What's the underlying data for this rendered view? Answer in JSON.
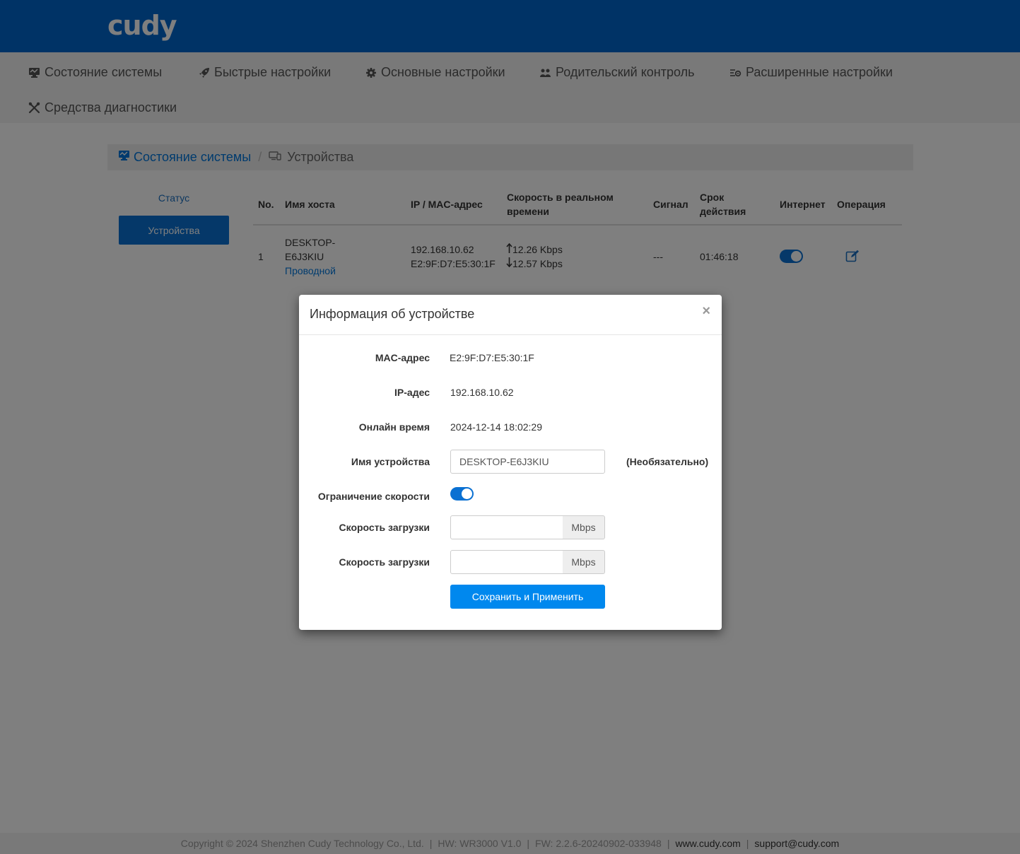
{
  "brand": {
    "logo": "cudy"
  },
  "nav": {
    "items": [
      {
        "label": "Состояние системы",
        "icon": "monitor-icon"
      },
      {
        "label": "Быстрые настройки",
        "icon": "rocket-icon"
      },
      {
        "label": "Основные настройки",
        "icon": "gear-icon"
      },
      {
        "label": "Родительский контроль",
        "icon": "users-icon"
      },
      {
        "label": "Расширенные настройки",
        "icon": "advanced-settings-icon"
      },
      {
        "label": "Средства диагностики",
        "icon": "tools-icon"
      }
    ]
  },
  "breadcrumb": {
    "parent": "Состояние системы",
    "separator": "/",
    "current": "Устройства"
  },
  "sidenav": {
    "status": "Статус",
    "devices": "Устройства"
  },
  "table": {
    "headers": {
      "no": "No.",
      "hostname": "Имя хоста",
      "ipmac": "IP / MAC-адрес",
      "speed_l1": "Скорость в реальном",
      "speed_l2": "времени",
      "signal": "Сигнал",
      "expiry_l1": "Срок",
      "expiry_l2": "действия",
      "internet": "Интернет",
      "operation": "Операция"
    },
    "rows": [
      {
        "no": "1",
        "host_l1": "DESKTOP-",
        "host_l2": "E6J3KIU",
        "conn": "Проводной",
        "ip": "192.168.10.62",
        "mac": "E2:9F:D7:E5:30:1F",
        "up": "12.26 Kbps",
        "down": "12.57 Kbps",
        "signal": "---",
        "expiry": "01:46:18",
        "internet_on": true
      }
    ]
  },
  "modal": {
    "title": "Информация об устройстве",
    "close": "×",
    "mac_label": "MAC-адрес",
    "mac_value": "E2:9F:D7:E5:30:1F",
    "ip_label": "IP-адес",
    "ip_value": "192.168.10.62",
    "online_label": "Онлайн время",
    "online_value": "2024-12-14 18:02:29",
    "name_label": "Имя устройства",
    "name_value": "DESKTOP-E6J3KIU",
    "name_hint": "(Необязательно)",
    "limit_label": "Ограничение скорости",
    "limit_on": true,
    "dl1_label": "Скорость загрузки",
    "dl1_value": "",
    "dl2_label": "Скорость загрузки",
    "dl2_value": "",
    "unit": "Mbps",
    "save": "Сохранить и Применить"
  },
  "footer": {
    "copyright": "Copyright © 2024 Shenzhen Cudy Technology Co., Ltd.",
    "hw": "HW: WR3000 V1.0",
    "fw": "FW: 2.2.6-20240902-033948",
    "site": "www.cudy.com",
    "email": "support@cudy.com",
    "sep": "|"
  },
  "colors": {
    "header": "#0066cc",
    "accent": "#0a70d2",
    "button": "#0088ee",
    "link": "#0077dd"
  }
}
